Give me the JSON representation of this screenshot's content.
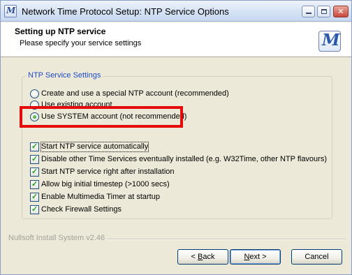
{
  "window": {
    "title": "Network Time Protocol Setup: NTP Service Options",
    "app_icon_glyph": "M",
    "minimize_label": "",
    "maximize_label": "",
    "close_label": "✕"
  },
  "header": {
    "title": "Setting up NTP service",
    "subtitle": "Please specify your service settings",
    "logo_glyph": "M"
  },
  "group": {
    "legend": "NTP Service Settings",
    "radios": [
      {
        "label": "Create and use a special NTP account  (recommended)",
        "selected": false
      },
      {
        "label": "Use existing account",
        "selected": false
      },
      {
        "label": "Use SYSTEM account (not recommended)",
        "selected": true
      }
    ],
    "checkboxes": [
      {
        "label": "Start NTP service automatically",
        "checked": true
      },
      {
        "label": "Disable other Time Services eventually installed (e.g. W32Time, other NTP flavours)",
        "checked": true
      },
      {
        "label": "Start NTP service right after installation",
        "checked": true
      },
      {
        "label": "Allow big initial timestep (>1000 secs)",
        "checked": true
      },
      {
        "label": "Enable Multimedia Timer at startup",
        "checked": true
      },
      {
        "label": "Check Firewall Settings",
        "checked": true
      }
    ]
  },
  "footer": {
    "branding": "Nullsoft Install System v2.46",
    "back_key": "B",
    "back_rest": "ack",
    "back_prefix": "< ",
    "next_key": "N",
    "next_rest": "ext >",
    "cancel_label": "Cancel"
  },
  "colors": {
    "highlight": "#e50b0b",
    "legend": "#1f4bc8",
    "check_mark": "#21a121"
  }
}
